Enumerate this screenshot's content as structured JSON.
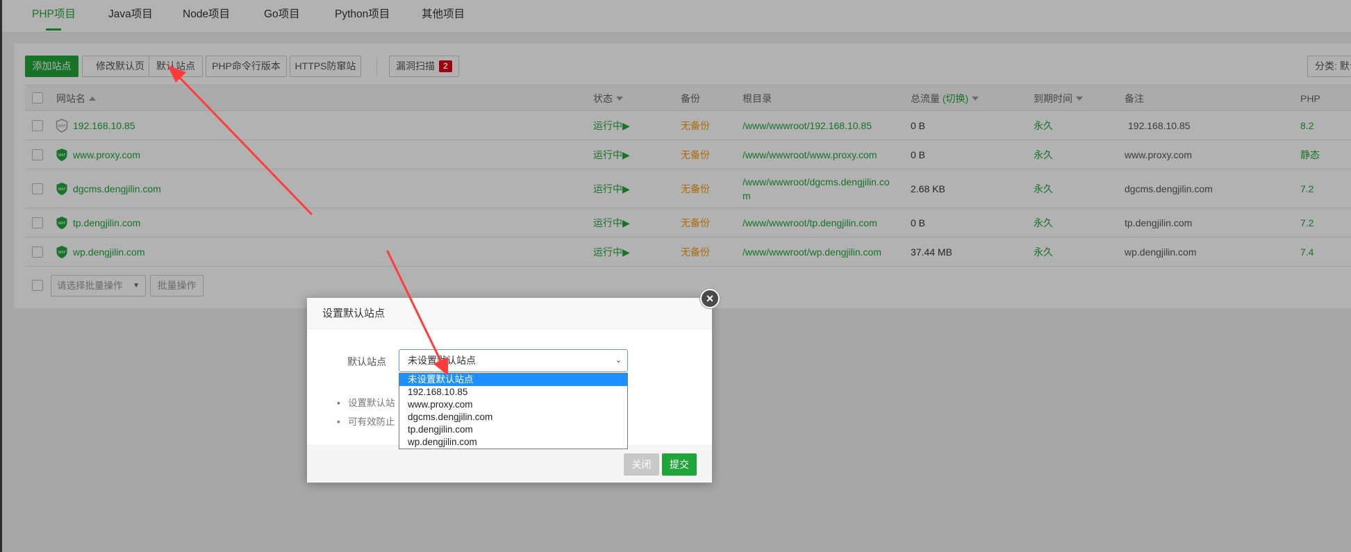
{
  "tabs": [
    {
      "label": "PHP项目"
    },
    {
      "label": "Java项目"
    },
    {
      "label": "Node项目"
    },
    {
      "label": "Go项目"
    },
    {
      "label": "Python项目"
    },
    {
      "label": "其他项目"
    }
  ],
  "toolbar": {
    "add_site": "添加站点",
    "modify_default_page": "修改默认页",
    "default_site": "默认站点",
    "php_cli_version": "PHP命令行版本",
    "https_anti_spoof": "HTTPS防窜站",
    "vuln_scan": "漏洞扫描",
    "vuln_count": "2",
    "category": "分类: 默认"
  },
  "table": {
    "headers": {
      "site_name": "网站名",
      "status": "状态",
      "backup": "备份",
      "root_dir": "根目录",
      "traffic": "总流量",
      "traffic_switch": "(切换)",
      "expire": "到期时间",
      "remark": "备注",
      "php": "PHP"
    },
    "rows": [
      {
        "name": "192.168.10.85",
        "status": "运行中",
        "backup": "无备份",
        "root": "/www/wwwroot/192.168.10.85",
        "root2": "",
        "traffic": "0 B",
        "expire": "永久",
        "remark": "192.168.10.85",
        "php": "8.2"
      },
      {
        "name": "www.proxy.com",
        "status": "运行中",
        "backup": "无备份",
        "root": "/www/wwwroot/www.proxy.com",
        "root2": "",
        "traffic": "0 B",
        "expire": "永久",
        "remark": "www.proxy.com",
        "php": "静态"
      },
      {
        "name": "dgcms.dengjilin.com",
        "status": "运行中",
        "backup": "无备份",
        "root": "/www/wwwroot/dgcms.dengjilin.co",
        "root2": "m",
        "traffic": "2.68 KB",
        "expire": "永久",
        "remark": "dgcms.dengjilin.com",
        "php": "7.2"
      },
      {
        "name": "tp.dengjilin.com",
        "status": "运行中",
        "backup": "无备份",
        "root": "/www/wwwroot/tp.dengjilin.com",
        "root2": "",
        "traffic": "0 B",
        "expire": "永久",
        "remark": "tp.dengjilin.com",
        "php": "7.2"
      },
      {
        "name": "wp.dengjilin.com",
        "status": "运行中",
        "backup": "无备份",
        "root": "/www/wwwroot/wp.dengjilin.com",
        "root2": "",
        "traffic": "37.44 MB",
        "expire": "永久",
        "remark": "wp.dengjilin.com",
        "php": "7.4"
      }
    ],
    "waf_label": "WAF"
  },
  "batch": {
    "select_placeholder": "请选择批量操作",
    "batch_button": "批量操作"
  },
  "dialog": {
    "title": "设置默认站点",
    "field_label": "默认站点",
    "selected": "未设置默认站点",
    "options": [
      "未设置默认站点",
      "192.168.10.85",
      "www.proxy.com",
      "dgcms.dengjilin.com",
      "tp.dengjilin.com",
      "wp.dengjilin.com"
    ],
    "tip1": "设置默认站",
    "tip2": "可有效防止",
    "close_button": "关闭",
    "submit_button": "提交"
  },
  "colors": {
    "accent": "#20a53a",
    "warning": "#f39c12",
    "annotation": "#ff3b3b",
    "badge": "#e60012"
  }
}
